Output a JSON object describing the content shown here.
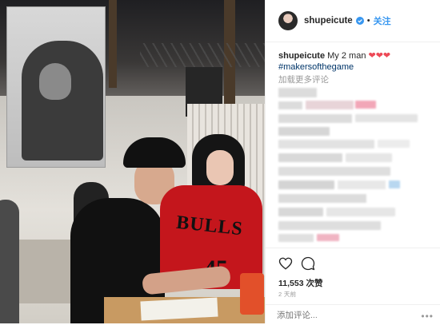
{
  "photo": {
    "jersey_text": "BULLS",
    "jersey_number": "45"
  },
  "header": {
    "username": "shupeicute",
    "separator": "•",
    "follow_label": "关注"
  },
  "caption": {
    "username": "shupeicute",
    "text": "My 2 man",
    "hearts": "❤❤❤",
    "hashtag": "#makersofthegame"
  },
  "load_more": "加载更多评论",
  "actions": {
    "likes": "11,553 次赞",
    "time_ago": "2 天前"
  },
  "comment": {
    "placeholder": "添加评论...",
    "more": "•••"
  },
  "colors": {
    "accent": "#3897f0",
    "heart": "#ed4956",
    "hashtag": "#003569",
    "jersey": "#c4161c"
  },
  "icons": [
    "verified-badge-icon",
    "heart-icon",
    "comment-icon",
    "more-options-icon"
  ]
}
